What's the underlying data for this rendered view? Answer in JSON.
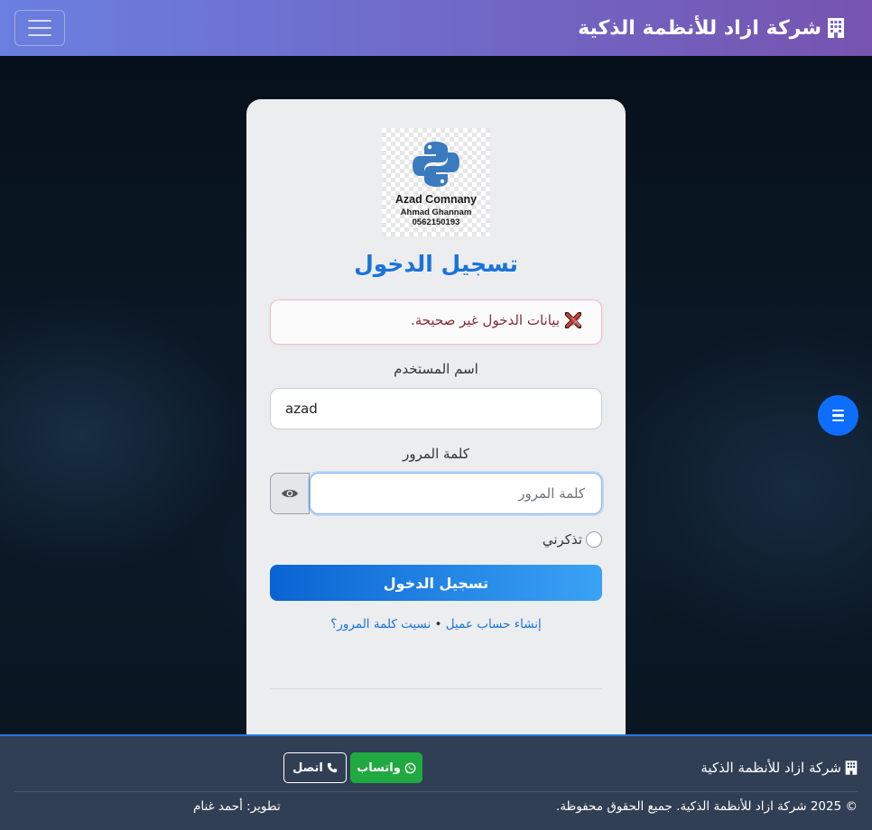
{
  "navbar": {
    "brand": "شركة ازاد للأنظمة الذكية",
    "brand_icon": "building-icon",
    "menu_icon": "hamburger-menu-icon"
  },
  "logo": {
    "company": "Azad Comnany",
    "person": "Ahmad Ghannam",
    "phone": "0562150193"
  },
  "login": {
    "title": "تسجيل الدخول",
    "error_message": "بيانات الدخول غير صحيحة.",
    "error_close": "×",
    "username_label": "اسم المستخدم",
    "username_value": "azad",
    "password_label": "كلمة المرور",
    "password_placeholder": "كلمة المرور",
    "remember_label": "تذكرني",
    "submit_label": "تسجيل الدخول",
    "register_link": "إنشاء حساب عميل",
    "separator": "•",
    "forgot_link": "نسيت كلمة المرور؟"
  },
  "footer": {
    "brand": "شركة ازاد للأنظمة الذكية",
    "whatsapp_label": "واتساب",
    "call_label": "اتصل",
    "copyright": "© 2025 شركة ازاد للأنظمة الذكية. جميع الحقوق محفوظة.",
    "developer": "تطوير: أحمد غنام"
  },
  "colors": {
    "navbar_start": "#6a7fe0",
    "navbar_end": "#7654b0",
    "accent": "#1a73d9",
    "whatsapp": "#20a940",
    "footer": "#313f55",
    "error_text": "#8a2a34"
  }
}
